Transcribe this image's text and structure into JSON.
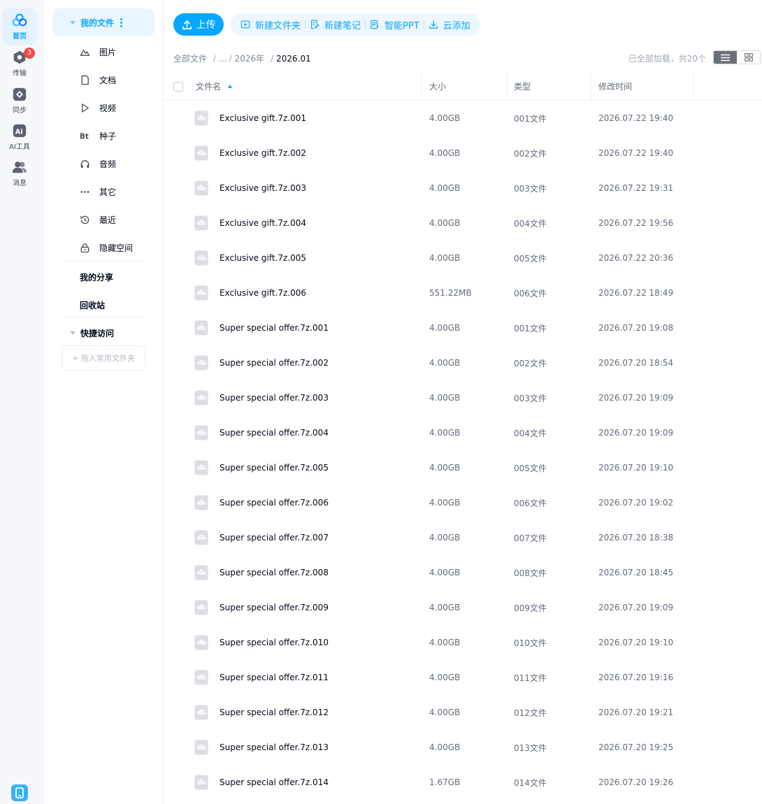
{
  "rail": {
    "items": [
      {
        "label": "首页",
        "icon": "home-cloud-icon",
        "active": true
      },
      {
        "label": "传输",
        "icon": "transfer-icon",
        "badge": "3"
      },
      {
        "label": "同步",
        "icon": "sync-icon"
      },
      {
        "label": "AI工具",
        "icon": "ai-tools-icon"
      },
      {
        "label": "消息",
        "icon": "message-icon"
      }
    ],
    "bottom_icon": "device-icon"
  },
  "sidebar": {
    "my_files": "我的文件",
    "categories": [
      {
        "label": "图片",
        "icon": "picture-icon"
      },
      {
        "label": "文档",
        "icon": "document-icon"
      },
      {
        "label": "视频",
        "icon": "video-icon"
      },
      {
        "label": "种子",
        "icon": "torrent-icon"
      },
      {
        "label": "音频",
        "icon": "audio-icon"
      },
      {
        "label": "其它",
        "icon": "other-icon"
      },
      {
        "label": "最近",
        "icon": "recent-icon"
      },
      {
        "label": "隐藏空间",
        "icon": "lock-icon"
      }
    ],
    "torrent_glyph": "Bt",
    "my_share": "我的分享",
    "recycle_bin": "回收站",
    "quick_access": "快捷访问",
    "quick_drop_hint": "+ 拖入常用文件夹"
  },
  "toolbar": {
    "upload": "上传",
    "new_folder": "新建文件夹",
    "new_note": "新建笔记",
    "smart_ppt": "智能PPT",
    "cloud_add": "云添加"
  },
  "breadcrumb": {
    "root": "全部文件",
    "ellipsis": "...",
    "year": "2026年",
    "current": "2026.01"
  },
  "loaded_info": "已全部加载，共20个",
  "table": {
    "headers": {
      "name": "文件名",
      "size": "大小",
      "type": "类型",
      "modified": "修改时间"
    },
    "rows": [
      {
        "name": "Exclusive gift.7z.001",
        "size": "4.00GB",
        "type": "001文件",
        "modified": "2026.07.22 19:40"
      },
      {
        "name": "Exclusive gift.7z.002",
        "size": "4.00GB",
        "type": "002文件",
        "modified": "2026.07.22 19:40"
      },
      {
        "name": "Exclusive gift.7z.003",
        "size": "4.00GB",
        "type": "003文件",
        "modified": "2026.07.22 19:31"
      },
      {
        "name": "Exclusive gift.7z.004",
        "size": "4.00GB",
        "type": "004文件",
        "modified": "2026.07.22 19:56"
      },
      {
        "name": "Exclusive gift.7z.005",
        "size": "4.00GB",
        "type": "005文件",
        "modified": "2026.07.22 20:36"
      },
      {
        "name": "Exclusive gift.7z.006",
        "size": "551.22MB",
        "type": "006文件",
        "modified": "2026.07.22 18:49"
      },
      {
        "name": "Super special offer.7z.001",
        "size": "4.00GB",
        "type": "001文件",
        "modified": "2026.07.20 19:08"
      },
      {
        "name": "Super special offer.7z.002",
        "size": "4.00GB",
        "type": "002文件",
        "modified": "2026.07.20 18:54"
      },
      {
        "name": "Super special offer.7z.003",
        "size": "4.00GB",
        "type": "003文件",
        "modified": "2026.07.20 19:09"
      },
      {
        "name": "Super special offer.7z.004",
        "size": "4.00GB",
        "type": "004文件",
        "modified": "2026.07.20 19:09"
      },
      {
        "name": "Super special offer.7z.005",
        "size": "4.00GB",
        "type": "005文件",
        "modified": "2026.07.20 19:10"
      },
      {
        "name": "Super special offer.7z.006",
        "size": "4.00GB",
        "type": "006文件",
        "modified": "2026.07.20 19:02"
      },
      {
        "name": "Super special offer.7z.007",
        "size": "4.00GB",
        "type": "007文件",
        "modified": "2026.07.20 18:38"
      },
      {
        "name": "Super special offer.7z.008",
        "size": "4.00GB",
        "type": "008文件",
        "modified": "2026.07.20 18:45"
      },
      {
        "name": "Super special offer.7z.009",
        "size": "4.00GB",
        "type": "009文件",
        "modified": "2026.07.20 19:09"
      },
      {
        "name": "Super special offer.7z.010",
        "size": "4.00GB",
        "type": "010文件",
        "modified": "2026.07.20 19:10"
      },
      {
        "name": "Super special offer.7z.011",
        "size": "4.00GB",
        "type": "011文件",
        "modified": "2026.07.20 19:16"
      },
      {
        "name": "Super special offer.7z.012",
        "size": "4.00GB",
        "type": "012文件",
        "modified": "2026.07.20 19:21"
      },
      {
        "name": "Super special offer.7z.013",
        "size": "4.00GB",
        "type": "013文件",
        "modified": "2026.07.20 19:25"
      },
      {
        "name": "Super special offer.7z.014",
        "size": "1.67GB",
        "type": "014文件",
        "modified": "2026.07.20 19:26"
      }
    ]
  },
  "colors": {
    "accent": "#06a7ff",
    "accent_light": "#eaf5fe",
    "badge": "#f54949",
    "text_primary": "#03081a",
    "text_secondary": "#636b7b",
    "file_icon": "#d9dbe0"
  }
}
